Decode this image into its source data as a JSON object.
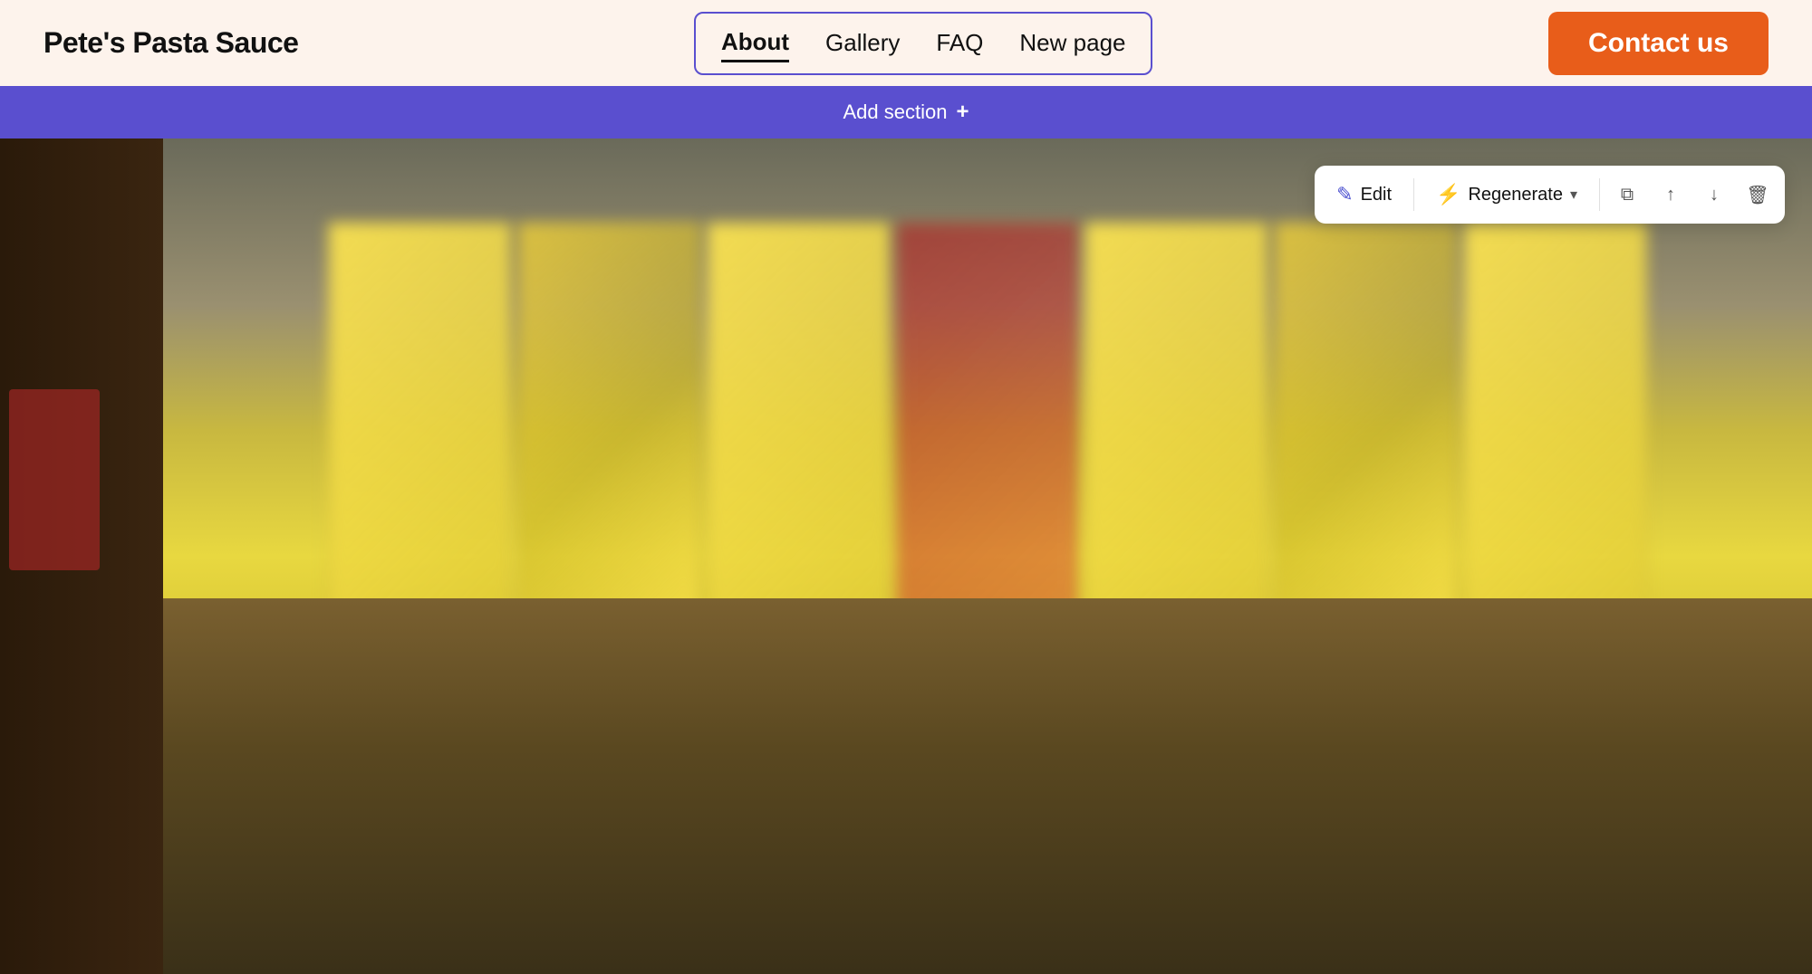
{
  "site": {
    "title": "Pete's Pasta Sauce"
  },
  "navbar": {
    "links": [
      {
        "label": "About",
        "active": true
      },
      {
        "label": "Gallery",
        "active": false
      },
      {
        "label": "FAQ",
        "active": false
      },
      {
        "label": "New page",
        "active": false
      }
    ],
    "contact_label": "Contact us"
  },
  "add_section": {
    "label": "Add section",
    "plus": "+"
  },
  "toolbar": {
    "edit_label": "Edit",
    "regenerate_label": "Regenerate",
    "edit_icon": "✎",
    "regen_icon": "⚡",
    "chevron_icon": "▾",
    "copy_icon": "⧉",
    "up_icon": "↑",
    "down_icon": "↓",
    "delete_icon": "🗑"
  },
  "colors": {
    "nav_border": "#5a4fcf",
    "contact_bg": "#e85d1a",
    "add_section_bg": "#5a4fcf",
    "active_underline": "#111"
  }
}
